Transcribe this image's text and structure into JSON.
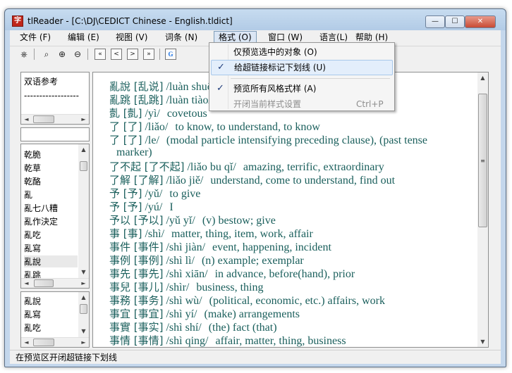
{
  "window": {
    "title": "tlReader - [C:\\DJ\\CEDICT Chinese - English.tldict]",
    "app_icon": "字"
  },
  "window_buttons": {
    "minimize": "—",
    "maximize": "☐",
    "close": "✕"
  },
  "menu": [
    "文件 (F)",
    "编辑 (E)",
    "视图 (V)",
    "词条 (N)",
    "格式 (O)",
    "窗口 (W)",
    "语言(L)",
    "帮助 (H)"
  ],
  "toolbar": {
    "binoculars_icon": "⎈",
    "search_icon": "⌕",
    "zoom_in_icon": "⊕",
    "zoom_out_icon": "⊖",
    "first_icon": "«",
    "prev_icon": "<",
    "next_icon": ">",
    "last_icon": "»",
    "google_icon": "G"
  },
  "ref_panel": {
    "title": "双语参考",
    "line": "------------------"
  },
  "word_list": [
    "乾脆",
    "乾草",
    "乾酪",
    "亂",
    "亂七八糟",
    "亂作決定",
    "亂吃",
    "亂寫",
    "亂說",
    "亂跳"
  ],
  "history_list": [
    "亂說",
    "亂寫",
    "亂吃"
  ],
  "entries": [
    {
      "hz": "亂說 [乱说]",
      "py": " /luàn shuō/",
      "def": ""
    },
    {
      "hz": "亂跳 [乱跳]",
      "py": " /luàn tiào/",
      "def": ""
    },
    {
      "hz": "亄 [亄]",
      "py": " /yì/",
      "def": "covetous"
    },
    {
      "hz": "了 [了]",
      "py": " /liǎo/",
      "def": "to know, to understand, to know"
    },
    {
      "hz": "了 [了]",
      "py": " /le/",
      "def": "(modal particle intensifying preceding clause), (past tense"
    },
    {
      "hz": "",
      "py": "",
      "def": "marker)"
    },
    {
      "hz": "了不起 [了不起]",
      "py": " /liǎo bu qǐ/",
      "def": "amazing, terrific, extraordinary"
    },
    {
      "hz": "了解 [了解]",
      "py": " /liǎo jiě/",
      "def": "understand, come to understand, find out"
    },
    {
      "hz": "予 [予]",
      "py": " /yǔ/",
      "def": "to give"
    },
    {
      "hz": "予 [予]",
      "py": " /yú/",
      "def": "I"
    },
    {
      "hz": "予以 [予以]",
      "py": " /yǔ yǐ/",
      "def": "(v) bestow; give"
    },
    {
      "hz": "事 [事]",
      "py": " /shì/",
      "def": "matter, thing, item, work, affair"
    },
    {
      "hz": "事件 [事件]",
      "py": " /shì jiàn/",
      "def": "event, happening, incident"
    },
    {
      "hz": "事例 [事例]",
      "py": " /shì lì/",
      "def": "(n) example; exemplar"
    },
    {
      "hz": "事先 [事先]",
      "py": " /shì xiān/",
      "def": "in advance, before(hand), prior"
    },
    {
      "hz": "事兒 [事儿]",
      "py": " /shìr/",
      "def": "business, thing"
    },
    {
      "hz": "事務 [事务]",
      "py": " /shì wù/",
      "def": "(political, economic, etc.) affairs, work"
    },
    {
      "hz": "事宜 [事宜]",
      "py": " /shì yí/",
      "def": "(make) arrangements"
    },
    {
      "hz": "事實 [事实]",
      "py": " /shì shí/",
      "def": "(the) fact (that)"
    },
    {
      "hz": "事情 [事情]",
      "py": " /shì qing/",
      "def": "affair, matter, thing, business"
    }
  ],
  "format_menu": {
    "items": [
      {
        "label": "仅预览选中的对象 (O)",
        "checked": false,
        "enabled": true,
        "shortcut": ""
      },
      {
        "label": "给超链接标记下划线 (U)",
        "checked": true,
        "enabled": true,
        "shortcut": ""
      },
      {
        "label": "预览所有风格式样 (A)",
        "checked": true,
        "enabled": true,
        "shortcut": ""
      },
      {
        "label": "开闭当前样式设置",
        "checked": false,
        "enabled": false,
        "shortcut": "Ctrl+P"
      }
    ],
    "check_glyph": "✓"
  },
  "status": {
    "text": "在预览区开闭超链接下划线"
  },
  "scroll_glyphs": {
    "up": "▲",
    "down": "▼",
    "left": "◄",
    "right": "►",
    "grip": "≡"
  },
  "colors": {
    "entry_text": "#1a5f5c",
    "menu_highlight": "#e3eefb",
    "check": "#1d3b7a"
  }
}
